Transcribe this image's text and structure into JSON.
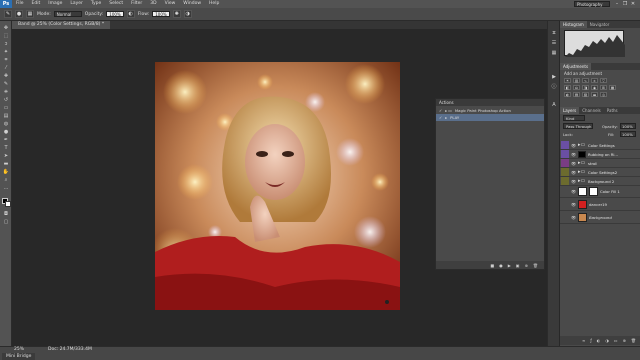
{
  "menubar": {
    "logo": "Ps",
    "items": [
      "File",
      "Edit",
      "Image",
      "Layer",
      "Type",
      "Select",
      "Filter",
      "3D",
      "View",
      "Window",
      "Help"
    ],
    "workspace": "Photography",
    "controls": [
      "–",
      "❐",
      "✕"
    ]
  },
  "options": {
    "mode_label": "Mode:",
    "mode_value": "Normal",
    "opacity_label": "Opacity:",
    "opacity_value": "100%",
    "flow_label": "Flow:",
    "flow_value": "100%"
  },
  "document": {
    "tab_title": "Band @ 25% (Color Settings, RGB/8) *",
    "zoom": "25%",
    "doc_info": "Doc: 24.7M/333.4M"
  },
  "panels": {
    "histogram_tabs": [
      "Histogram",
      "Navigator"
    ],
    "adjustments_tabs": [
      "Adjustments"
    ],
    "adjustments_title": "Add an adjustment",
    "layers_tabs": [
      "Layers",
      "Channels",
      "Paths"
    ],
    "layers_kind": "Kind",
    "blend_mode": "Pass Through",
    "opacity_label": "Opacity:",
    "opacity_value": "100%",
    "lock_label": "Lock:",
    "fill_label": "Fill:",
    "fill_value": "100%",
    "layers": [
      {
        "name": "Color Settings",
        "color": "#6a4fa3",
        "type": "folder"
      },
      {
        "name": "Rubbing on Ri...",
        "color": "#6a4fa3",
        "type": "layer"
      },
      {
        "name": "stroll",
        "color": "#7a3d84",
        "type": "folder"
      },
      {
        "name": "Color Settings2",
        "color": "#6c6b2e",
        "type": "folder"
      },
      {
        "name": "Background 2",
        "color": "#6c6b2e",
        "type": "folder"
      },
      {
        "name": "Color Fill 1",
        "color": "#4a4a4a",
        "type": "layer"
      },
      {
        "name": "dancer19",
        "color": "#4a4a4a",
        "type": "layer"
      },
      {
        "name": "Background",
        "color": "#4a4a4a",
        "type": "layer"
      }
    ]
  },
  "actions": {
    "tab": "Actions",
    "set_name": "Magic Paint Photoshop Action",
    "action_name": "PLAY",
    "footer_icons": [
      "■",
      "●",
      "▶",
      "▣",
      "⊕",
      "🗑"
    ]
  },
  "status": {
    "mini_bridge": "Mini Bridge"
  },
  "colors": {
    "accent_folder_purple": "#6a4fa3",
    "accent_folder_olive": "#6c6b2e"
  }
}
